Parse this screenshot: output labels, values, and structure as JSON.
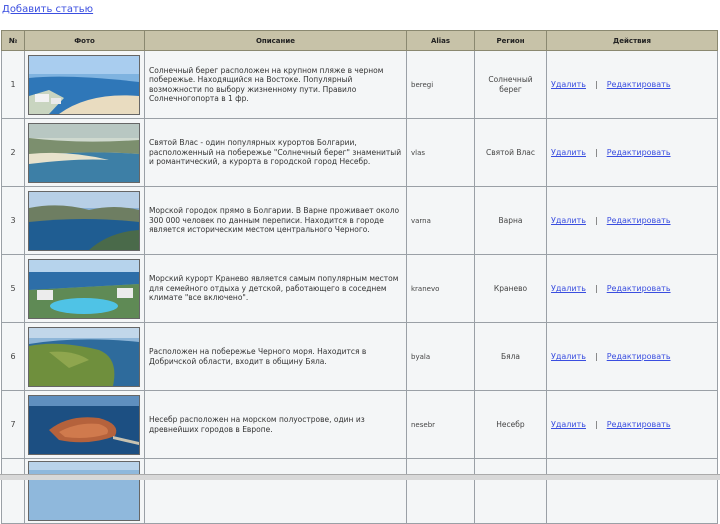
{
  "add_link": "Добавить статью",
  "columns": [
    "№",
    "Фото",
    "Описание",
    "Alias",
    "Регион",
    "Действия"
  ],
  "delete_label": "Удалить",
  "separator": "|",
  "edit_label": "Редактировать",
  "rows": [
    {
      "num": "1",
      "photo": "coast-beach-resort",
      "description": "Солнечный берег расположен на крупном пляже в черном побережье. Находящийся на Востоке. Популярный возможности по выбору жизненному пути. Правило Солнечногопорта в 1 фр.",
      "alias": "beregi",
      "region": "Солнечный берег"
    },
    {
      "num": "2",
      "photo": "coastal-bay",
      "description": "Святой Влас - один популярных курортов Болгарии, расположенный на побережье \"Солнечный берег\" знаменитый и романтический, а курорта в городской город Несебр.",
      "alias": "vlas",
      "region": "Святой Влас"
    },
    {
      "num": "3",
      "photo": "bay-cityscape",
      "description": "Морской городок прямо в Болгарии. В Варне проживает около 300 000 человек по данным переписи. Находится в городе является историческим местом центрального Черного.",
      "alias": "varna",
      "region": "Варна"
    },
    {
      "num": "5",
      "photo": "resort-pool",
      "description": "Морский курорт Кранево является самым популярным местом для семейного отдыха у детской, работающего в соседнем климате \"все включено\".",
      "alias": "kranevo",
      "region": "Кранево"
    },
    {
      "num": "6",
      "photo": "green-cape",
      "description": "Расположен на побережье Черного моря. Находится в Добричской области, входит в общину Бяла.",
      "alias": "byala",
      "region": "Бяла"
    },
    {
      "num": "7",
      "photo": "island-old-town",
      "description": "Несебр расположен на морском полуострове, один из древнейших городов в Европе.",
      "alias": "nesebr",
      "region": "Несебр"
    },
    {
      "num": "",
      "photo": "coast-partial",
      "description": "",
      "alias": "",
      "region": ""
    }
  ]
}
